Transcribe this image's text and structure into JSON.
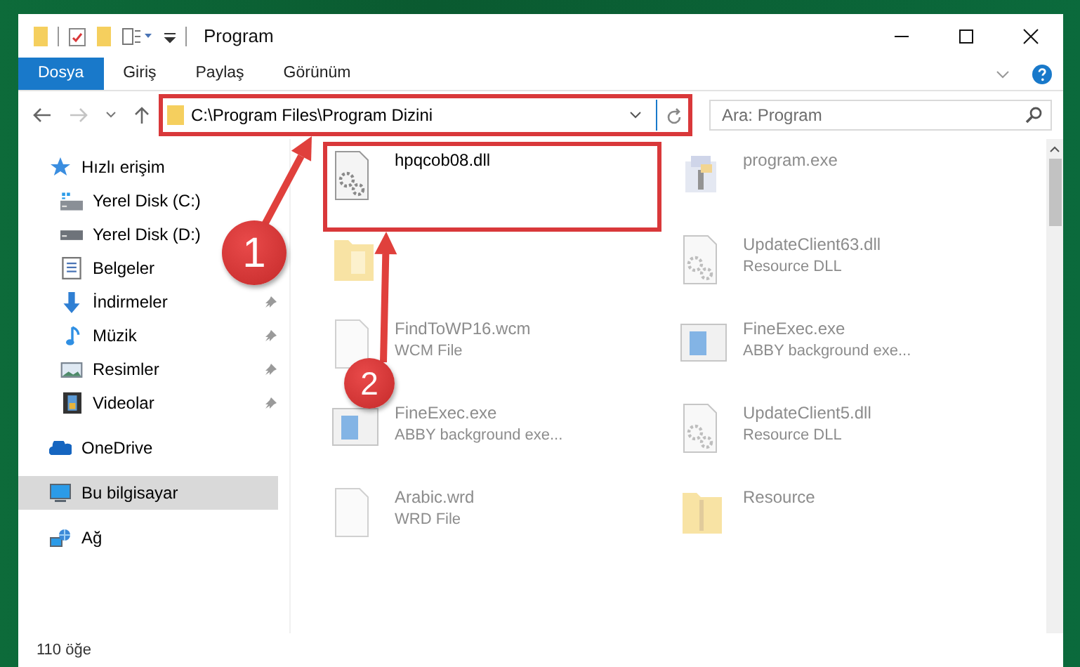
{
  "window": {
    "title": "Program"
  },
  "ribbon": {
    "tabs": [
      {
        "label": "Dosya",
        "selected": true
      },
      {
        "label": "Giriş",
        "selected": false
      },
      {
        "label": "Paylaş",
        "selected": false
      },
      {
        "label": "Görünüm",
        "selected": false
      }
    ]
  },
  "address": {
    "path": "C:\\Program Files\\Program Dizini",
    "highlighted": true
  },
  "search": {
    "placeholder": "Ara: Program"
  },
  "sidebar": {
    "items": [
      {
        "label": "Hızlı erişim",
        "kind": "star",
        "selected": false,
        "children": [
          {
            "label": "Yerel Disk (C:)",
            "kind": "drive-c",
            "pinned": false,
            "selected": false
          },
          {
            "label": "Yerel Disk (D:)",
            "kind": "drive",
            "pinned": false,
            "selected": false
          },
          {
            "label": "Belgeler",
            "kind": "document",
            "pinned": false,
            "selected": false
          },
          {
            "label": "İndirmeler",
            "kind": "download",
            "pinned": true,
            "selected": false
          },
          {
            "label": "Müzik",
            "kind": "music",
            "pinned": true,
            "selected": false
          },
          {
            "label": "Resimler",
            "kind": "pictures",
            "pinned": true,
            "selected": false
          },
          {
            "label": "Videolar",
            "kind": "video",
            "pinned": true,
            "selected": false
          }
        ]
      },
      {
        "label": "OneDrive",
        "kind": "cloud",
        "selected": false
      },
      {
        "label": "Bu bilgisayar",
        "kind": "computer",
        "selected": true
      },
      {
        "label": "Ağ",
        "kind": "network",
        "selected": false
      }
    ]
  },
  "files": [
    {
      "name": "hpqcob08.dll",
      "kind": "dll",
      "highlighted": true,
      "blurred": false
    },
    {
      "name": "program.exe",
      "kind": "installer",
      "highlighted": false,
      "blurred": true
    },
    {
      "kind": "folder",
      "highlighted": false,
      "blurred": true
    },
    {
      "name": "UpdateClient63.dll",
      "type": "Resource DLL",
      "kind": "dll",
      "highlighted": false,
      "blurred": true
    },
    {
      "name": "FindToWP16.wcm",
      "type": "WCM File",
      "kind": "file",
      "highlighted": false,
      "blurred": true
    },
    {
      "name": "FineExec.exe",
      "type": "ABBY background exe...",
      "kind": "app",
      "highlighted": false,
      "blurred": true
    },
    {
      "name": "FineExec.exe",
      "type": "ABBY background exe...",
      "kind": "app",
      "highlighted": false,
      "blurred": true
    },
    {
      "name": "UpdateClient5.dll",
      "type": "Resource DLL",
      "kind": "dll",
      "highlighted": false,
      "blurred": true
    },
    {
      "name": "Arabic.wrd",
      "type": "WRD File",
      "kind": "file",
      "highlighted": false,
      "blurred": true
    },
    {
      "name": "Resource",
      "kind": "zip-folder",
      "highlighted": false,
      "blurred": true
    }
  ],
  "annotations": [
    {
      "label": "1",
      "kind": "to-address"
    },
    {
      "label": "2",
      "kind": "to-file"
    }
  ],
  "status_bar": {
    "count": "110 öğe"
  }
}
